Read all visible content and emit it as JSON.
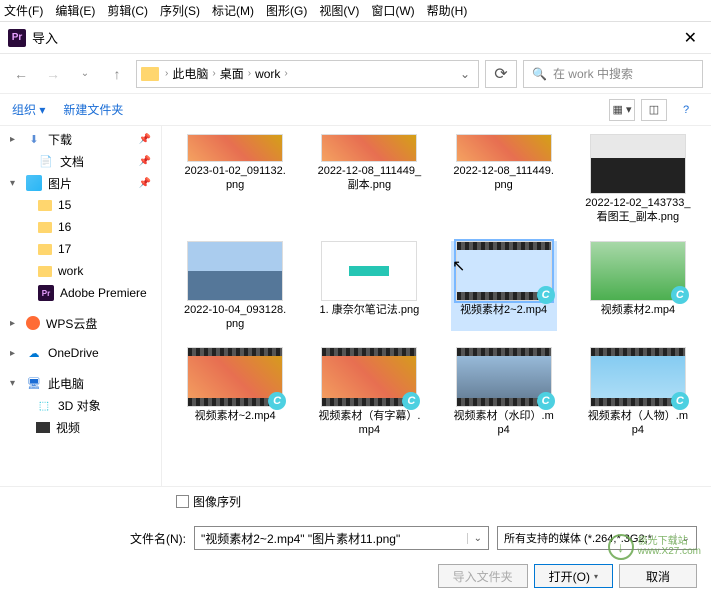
{
  "menubar": [
    "文件(F)",
    "编辑(E)",
    "剪辑(C)",
    "序列(S)",
    "标记(M)",
    "图形(G)",
    "视图(V)",
    "窗口(W)",
    "帮助(H)"
  ],
  "dialog": {
    "title": "导入",
    "close": "✕"
  },
  "breadcrumb": {
    "items": [
      "此电脑",
      "桌面",
      "work"
    ],
    "sep": "›"
  },
  "search": {
    "placeholder": "在 work 中搜索",
    "icon": "🔍"
  },
  "toolbar": {
    "organize": "组织 ▾",
    "newfolder": "新建文件夹"
  },
  "sidebar": [
    {
      "icon": "dl",
      "label": "下载",
      "pin": true,
      "arrow": "▸"
    },
    {
      "icon": "doc",
      "label": "文档",
      "pin": true
    },
    {
      "icon": "pic",
      "label": "图片",
      "pin": true,
      "arrow": "▾"
    },
    {
      "icon": "folder",
      "label": "15"
    },
    {
      "icon": "folder",
      "label": "16"
    },
    {
      "icon": "folder",
      "label": "17"
    },
    {
      "icon": "folder",
      "label": "work"
    },
    {
      "icon": "pr",
      "label": "Adobe Premiere"
    },
    {
      "icon": "wps",
      "label": "WPS云盘",
      "arrow": "▸"
    },
    {
      "icon": "od",
      "label": "OneDrive",
      "arrow": "▸"
    },
    {
      "icon": "pc",
      "label": "此电脑",
      "arrow": "▾"
    },
    {
      "icon": "3d",
      "label": "3D 对象",
      "indent": true
    },
    {
      "icon": "vid",
      "label": "视频",
      "indent": true
    }
  ],
  "files_r1": [
    {
      "name": "2023-01-02_091132.png",
      "cls": "t-leaves",
      "short": true
    },
    {
      "name": "2022-12-08_111449_副本.png",
      "cls": "t-leaves",
      "short": true
    },
    {
      "name": "2022-12-08_111449.png",
      "cls": "t-leaves",
      "short": true
    },
    {
      "name": "2022-12-02_143733_看图王_副本.png",
      "cls": "t-suit"
    }
  ],
  "files_r2": [
    {
      "name": "2022-10-04_093128.png",
      "cls": "t-fuji"
    },
    {
      "name": "1. 康奈尔笔记法.png",
      "cls": "t-note"
    },
    {
      "name": "视频素材2~2.mp4",
      "cls": "t-city",
      "film": true,
      "badge": true,
      "selected": true
    },
    {
      "name": "视频素材2.mp4",
      "cls": "t-green",
      "badge": true
    }
  ],
  "files_r3": [
    {
      "name": "视频素材~2.mp4",
      "cls": "t-leaves",
      "film": true,
      "badge": true
    },
    {
      "name": "视频素材（有字幕）.mp4",
      "cls": "t-leaves",
      "film": true,
      "badge": true
    },
    {
      "name": "视频素材（水印）.mp4",
      "cls": "t-city",
      "film": true,
      "badge": true
    },
    {
      "name": "视频素材（人物）.mp4",
      "cls": "t-sky",
      "film": true,
      "badge": true
    }
  ],
  "imageSeq": "图像序列",
  "filename": {
    "label": "文件名(N):",
    "value": "\"视频素材2~2.mp4\" \"图片素材11.png\""
  },
  "filetype": {
    "value": "所有支持的媒体 (*.264;*.3G2;*"
  },
  "buttons": {
    "importFolder": "导入文件夹",
    "open": "打开(O)",
    "cancel": "取消"
  },
  "watermark": {
    "site": "极光下载站",
    "url": "www.X27.com"
  }
}
